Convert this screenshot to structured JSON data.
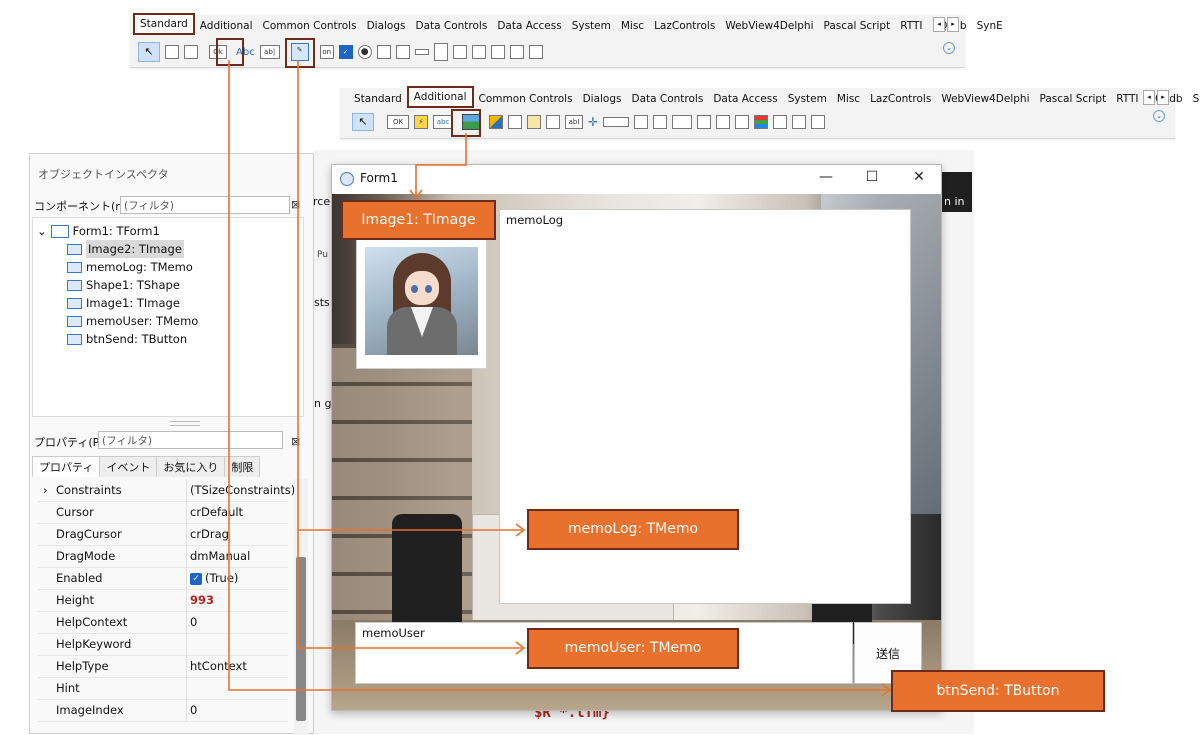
{
  "palette_top": {
    "tabs": [
      "Standard",
      "Additional",
      "Common Controls",
      "Dialogs",
      "Data Controls",
      "Data Access",
      "System",
      "Misc",
      "LazControls",
      "WebView4Delphi",
      "Pascal Script",
      "RTTI",
      "SQLdb",
      "SynE"
    ],
    "active_tab": "Standard",
    "button_icon_text": "Ok",
    "label_icon_text": "Abc",
    "edit_icon_text": "ab|",
    "toggle_icon_text": "on",
    "nav_left": "◂",
    "nav_right": "▸",
    "expand_glyph": "⌄"
  },
  "palette_bottom": {
    "tabs": [
      "Standard",
      "Additional",
      "Common Controls",
      "Dialogs",
      "Data Controls",
      "Data Access",
      "System",
      "Misc",
      "LazControls",
      "WebView4Delphi",
      "Pascal Script",
      "RTTI",
      "SQLdb",
      "SynE"
    ],
    "active_tab": "Additional",
    "bitbtn_icon_text": "OK",
    "statictext_icon_text": "abc",
    "labelededit_icon_text": "abI",
    "nav_left": "◂",
    "nav_right": "▸",
    "expand_glyph": "⌄"
  },
  "inspector": {
    "title": "オブジェクトインスペクタ",
    "components_label": "コンポーネント(m)",
    "components_filter_placeholder": "(フィルタ)",
    "tree": [
      {
        "label": "Form1: TForm1",
        "root": true
      },
      {
        "label": "Image2: TImage",
        "selected": true
      },
      {
        "label": "memoLog: TMemo"
      },
      {
        "label": "Shape1: TShape"
      },
      {
        "label": "Image1: TImage"
      },
      {
        "label": "memoUser: TMemo"
      },
      {
        "label": "btnSend: TButton"
      }
    ],
    "properties_label": "プロパティ(P)",
    "properties_filter_placeholder": "(フィルタ)",
    "tabs": [
      "プロパティ",
      "イベント",
      "お気に入り",
      "制限"
    ],
    "active_tab": "プロパティ",
    "properties": [
      {
        "name": "Constraints",
        "value": "(TSizeConstraints)",
        "expandable": true
      },
      {
        "name": "Cursor",
        "value": "crDefault"
      },
      {
        "name": "DragCursor",
        "value": "crDrag"
      },
      {
        "name": "DragMode",
        "value": "dmManual"
      },
      {
        "name": "Enabled",
        "value": "(True)",
        "checkbox": true
      },
      {
        "name": "Height",
        "value": "993",
        "highlight": true
      },
      {
        "name": "HelpContext",
        "value": "0"
      },
      {
        "name": "HelpKeyword",
        "value": ""
      },
      {
        "name": "HelpType",
        "value": "htContext"
      },
      {
        "name": "Hint",
        "value": ""
      },
      {
        "name": "ImageIndex",
        "value": "0"
      }
    ],
    "filter_clear_icon": "⊠"
  },
  "background_ide": {
    "fragments": [
      "rce",
      "Pu",
      "sts",
      "n gi",
      "n in"
    ],
    "code_text": "$R *.lfm}",
    "code_marker": "."
  },
  "form": {
    "title": "Form1",
    "minimize": "—",
    "maximize": "☐",
    "close": "✕",
    "memo_log_text": "memoLog",
    "memo_user_text": "memoUser",
    "send_button_label": "送信"
  },
  "callouts": {
    "image1": "Image1: TImage",
    "memolog": "memoLog: TMemo",
    "memouser": "memoUser: TMemo",
    "btnsend": "btnSend: TButton"
  },
  "colors": {
    "callout_fill": "#e8712d",
    "callout_border": "#6e2b1c",
    "connector_line": "#e8712d"
  }
}
